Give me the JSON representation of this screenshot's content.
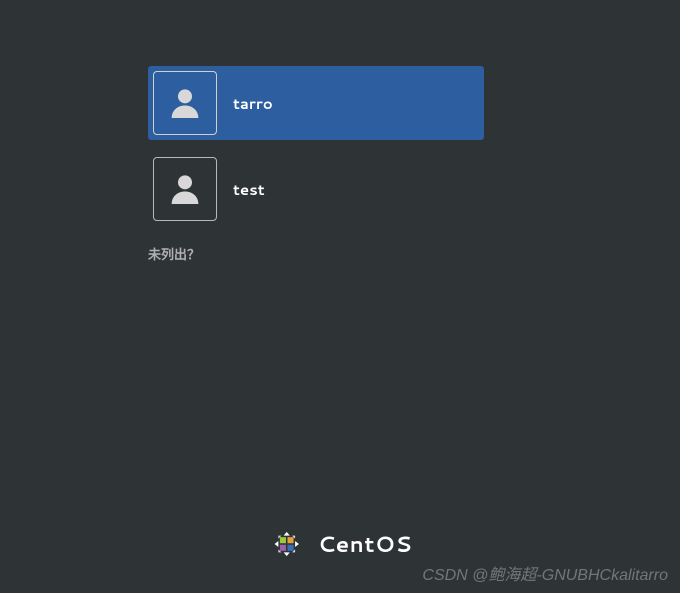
{
  "users": [
    {
      "name": "tarro",
      "selected": true
    },
    {
      "name": "test",
      "selected": false
    }
  ],
  "not_listed_label": "未列出？",
  "brand": {
    "name": "CentOS"
  },
  "watermark": "CSDN @鲍海超-GNUBHCkalitarro",
  "colors": {
    "background": "#2e3436",
    "selected": "#2d5e9f"
  }
}
